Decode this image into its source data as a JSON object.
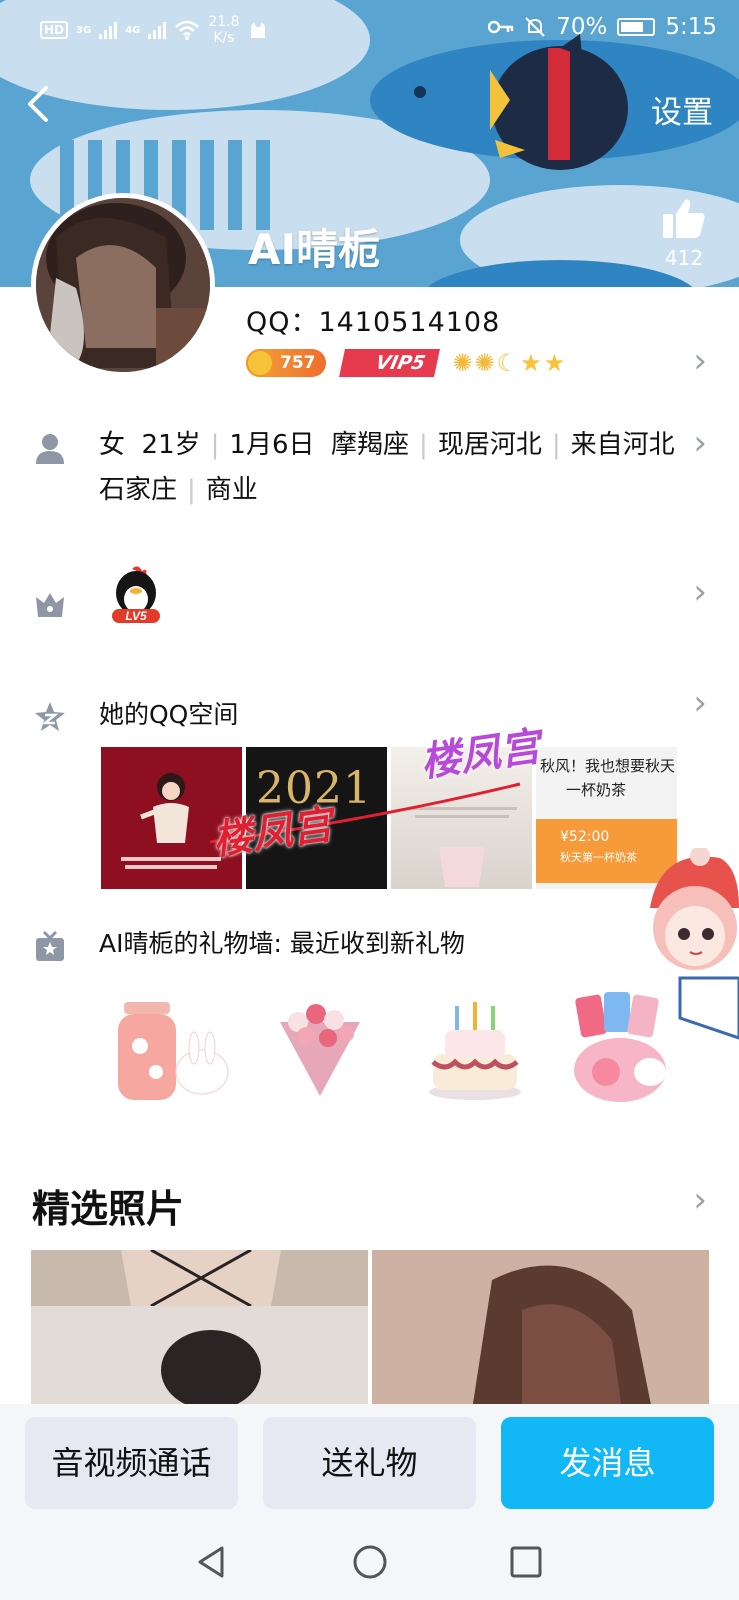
{
  "status_bar": {
    "network_hd": "HD",
    "sim1": "3G",
    "sim2": "4G",
    "speed_value": "21.8",
    "speed_unit": "K/s",
    "battery": "70%",
    "time": "5:15"
  },
  "header": {
    "settings_label": "设置",
    "like_count": "412",
    "nickname": "AI晴栀"
  },
  "profile": {
    "qq_line": "QQ：1410514108",
    "coin_count": "757",
    "vip_label": "VIP5"
  },
  "info": {
    "items": [
      "女",
      "21岁",
      "1月6日",
      "摩羯座",
      "现居河北",
      "来自河北石家庄",
      "商业"
    ]
  },
  "level_badge": "LV5",
  "qzone": {
    "title": "她的QQ空间",
    "photo2_text": "2021",
    "photo4_line1": "秋风！我也想要秋天",
    "photo4_line2": "一杯奶茶",
    "photo4_price": "¥52:00",
    "photo4_caption": "秋天第一杯奶茶",
    "watermark": "楼凤宫"
  },
  "gift_wall": {
    "title": "AI晴栀的礼物墙: 最近收到新礼物"
  },
  "featured": {
    "title": "精选照片"
  },
  "actions": {
    "call": "音视频通话",
    "gift": "送礼物",
    "message": "发消息"
  },
  "colors": {
    "header_bg": "#4f9fcf",
    "primary_button": "#12b7f5",
    "secondary_button": "#e6e9f1",
    "vip_red": "#e63a4e"
  }
}
